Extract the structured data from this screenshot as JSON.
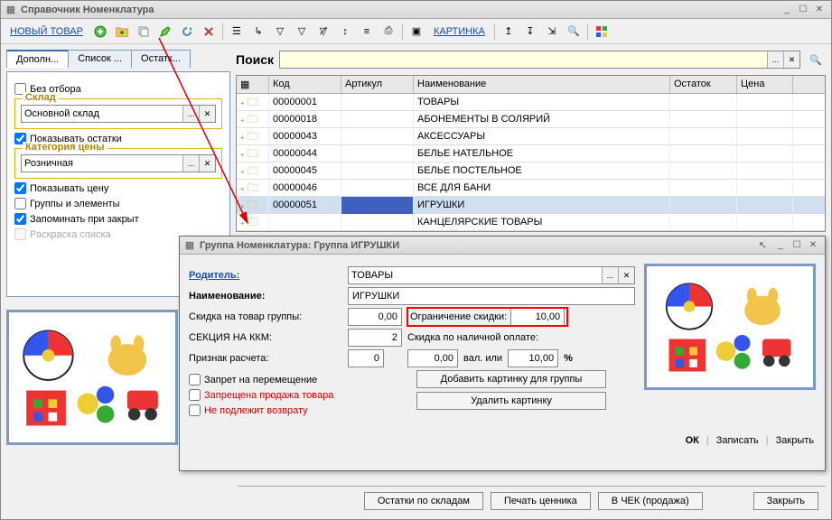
{
  "main_window": {
    "title": "Справочник Номенклатура",
    "toolbar": {
      "new_item": "НОВЫЙ ТОВАР",
      "picture": "КАРТИНКА"
    }
  },
  "left_panel": {
    "tabs": [
      "Дополн...",
      "Список ...",
      "Остатк..."
    ],
    "no_filter": "Без отбора",
    "warehouse_group": "Склад",
    "warehouse_value": "Основной склад",
    "show_stock": "Показывать остатки",
    "price_cat_group": "Категория цены",
    "price_cat_value": "Розничная",
    "show_price": "Показывать цену",
    "groups_elems": "Группы и элементы",
    "remember": "Запоминать при закрыт",
    "coloring": "Раскраска списка"
  },
  "search": {
    "label": "Поиск",
    "value": ""
  },
  "grid": {
    "headers": {
      "code": "Код",
      "article": "Артикул",
      "name": "Наименование",
      "stock": "Остаток",
      "price": "Цена"
    },
    "rows": [
      {
        "code": "00000001",
        "name": "ТОВАРЫ"
      },
      {
        "code": "00000018",
        "name": "АБОНЕМЕНТЫ В СОЛЯРИЙ"
      },
      {
        "code": "00000043",
        "name": "АКСЕССУАРЫ"
      },
      {
        "code": "00000044",
        "name": "БЕЛЬЕ НАТЕЛЬНОЕ"
      },
      {
        "code": "00000045",
        "name": "БЕЛЬЕ ПОСТЕЛЬНОЕ"
      },
      {
        "code": "00000046",
        "name": "ВСЕ ДЛЯ БАНИ"
      },
      {
        "code": "00000051",
        "name": "ИГРУШКИ"
      },
      {
        "code": "",
        "name": "КАНЦЕЛЯРСКИЕ ТОВАРЫ"
      }
    ]
  },
  "bottom": {
    "stock_by_wh": "Остатки по складам",
    "print_tag": "Печать ценника",
    "to_check": "В ЧЕК (продажа)",
    "close": "Закрыть"
  },
  "dialog": {
    "title": "Группа Номенклатура: Группа ИГРУШКИ",
    "parent_label": "Родитель:",
    "parent_value": "ТОВАРЫ",
    "name_label": "Наименование:",
    "name_value": "ИГРУШКИ",
    "discount_label": "Скидка на товар группы:",
    "discount_value": "0,00",
    "limit_label": "Ограничение скидки:",
    "limit_value": "10,00",
    "section_label": "СЕКЦИЯ НА ККМ:",
    "section_value": "2",
    "cash_discount_label": "Скидка по наличной оплате:",
    "calc_label": "Признак расчета:",
    "calc_value": "0",
    "cash_value1": "0,00",
    "cash_val_or": "вал. или",
    "cash_value2": "10,00",
    "cash_pct": "%",
    "no_move": "Запрет на перемещение",
    "no_sale": "Запрещена продажа товара",
    "no_return": "Не подлежит возврату",
    "add_pic": "Добавить картинку для группы",
    "del_pic": "Удалить картинку",
    "ok": "ОК",
    "save": "Записать",
    "close": "Закрыть"
  }
}
